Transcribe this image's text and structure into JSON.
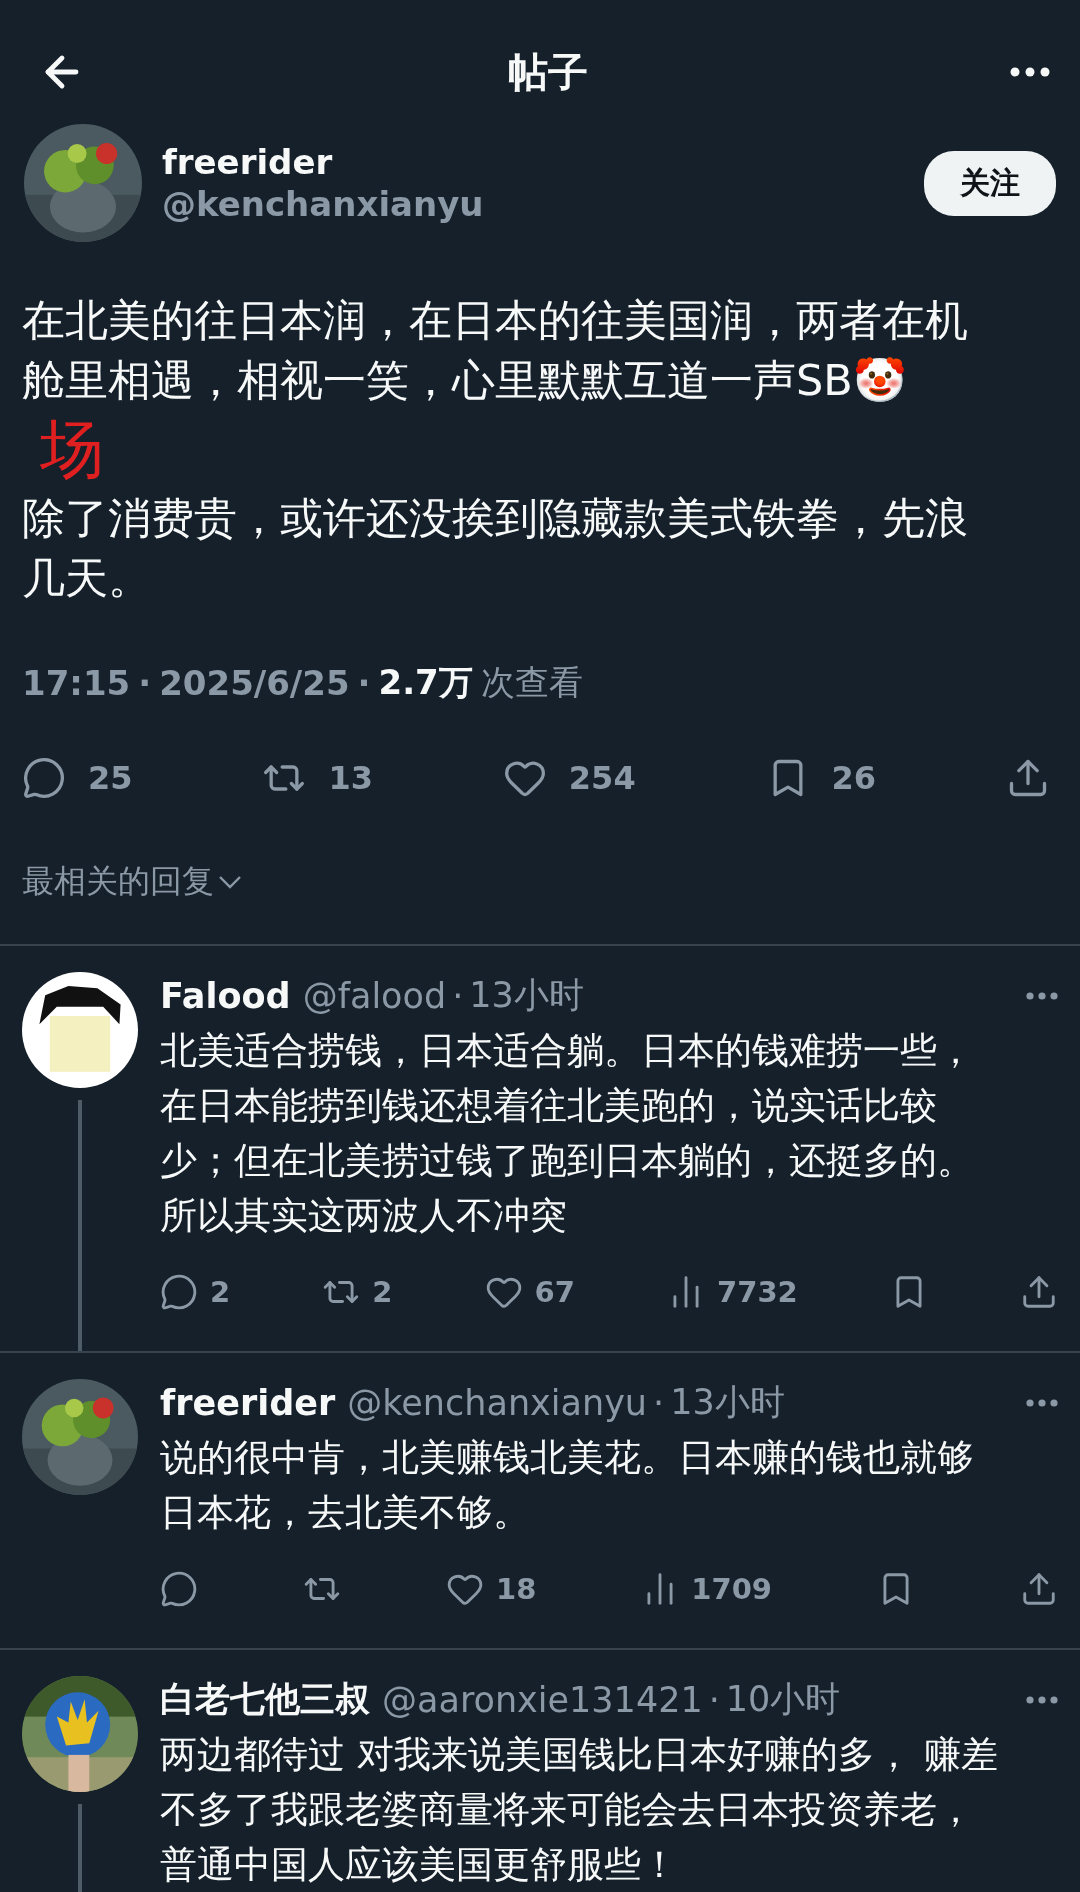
{
  "header": {
    "title": "帖子"
  },
  "post": {
    "author_name": "freerider",
    "handle": "@kenchanxianyu",
    "follow_button": "关注",
    "paragraphs": [
      "在北美的往日本润，在日本的往美国润，两者在机舱里相遇，相视一笑，心里默默互道一声SB🤡",
      "除了消费贵，或许还没挨到隐藏款美式铁拳，先浪几天。"
    ],
    "annotation": "场",
    "time": "17:15",
    "date": "2025/6/25",
    "views_count": "2.7万",
    "views_label": "次查看",
    "separator": "·",
    "actions": [
      {
        "kind": "reply",
        "count": "25"
      },
      {
        "kind": "repost",
        "count": "13"
      },
      {
        "kind": "like",
        "count": "254"
      },
      {
        "kind": "bookmark",
        "count": "26"
      },
      {
        "kind": "share"
      }
    ]
  },
  "sort_label": "最相关的回复",
  "replies": [
    {
      "name": "Falood",
      "handle": "@falood",
      "separator": "·",
      "time": "13小时",
      "thread_line": true,
      "text": "北美适合捞钱，日本适合躺。日本的钱难捞一些，在日本能捞到钱还想着往北美跑的，说实话比较少；但在北美捞过钱了跑到日本躺的，还挺多的。所以其实这两波人不冲突",
      "actions": [
        {
          "kind": "reply",
          "count": "2"
        },
        {
          "kind": "repost",
          "count": "2"
        },
        {
          "kind": "like",
          "count": "67"
        },
        {
          "kind": "views",
          "count": "7732"
        },
        {
          "kind": "bookmark"
        },
        {
          "kind": "share"
        }
      ]
    },
    {
      "name": "freerider",
      "handle": "@kenchanxianyu",
      "separator": "·",
      "time": "13小时",
      "thread_line": false,
      "text": "说的很中肯，北美赚钱北美花。日本赚的钱也就够日本花，去北美不够。",
      "actions": [
        {
          "kind": "reply"
        },
        {
          "kind": "repost"
        },
        {
          "kind": "like",
          "count": "18"
        },
        {
          "kind": "views",
          "count": "1709"
        },
        {
          "kind": "bookmark"
        },
        {
          "kind": "share"
        }
      ]
    },
    {
      "name": "白老七他三叔",
      "handle": "@aaronxie131421",
      "separator": "·",
      "time": "10小时",
      "thread_line": true,
      "text": "两边都待过 对我来说美国钱比日本好赚的多， 赚差不多了我跟老婆商量将来可能会去日本投资养老，普通中国人应该美国更舒服些！"
    }
  ]
}
